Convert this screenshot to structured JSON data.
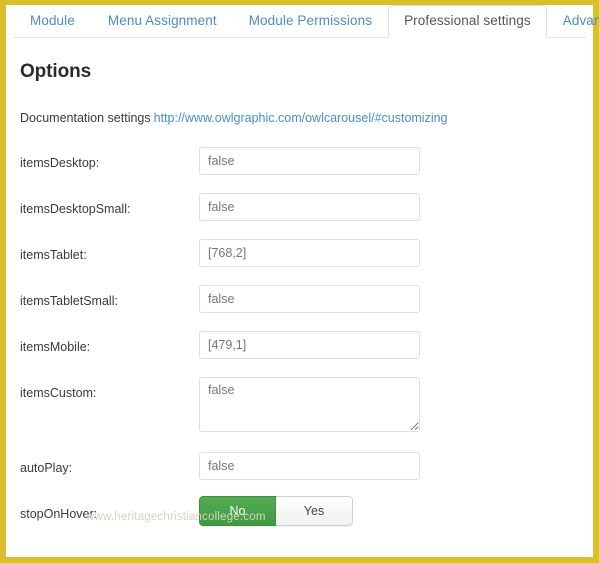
{
  "window": {
    "border_color": "#d9bf2b",
    "accent_link_color": "#4a8fc0",
    "toggle_green": "#449d44"
  },
  "tabs": [
    {
      "label": "Module",
      "active": false
    },
    {
      "label": "Menu Assignment",
      "active": false
    },
    {
      "label": "Module Permissions",
      "active": false
    },
    {
      "label": "Professional settings",
      "active": true
    },
    {
      "label": "Advanced",
      "active": false
    }
  ],
  "main": {
    "page_title": "Options",
    "documentation": {
      "label": "Documentation settings",
      "link_text": "http://www.owlgraphic.com/owlcarousel/#customizing"
    }
  },
  "fields": [
    {
      "label": "itemsDesktop:",
      "value": "false",
      "type": "text"
    },
    {
      "label": "itemsDesktopSmall:",
      "value": "false",
      "type": "text"
    },
    {
      "label": "itemsTablet:",
      "value": "[768,2]",
      "type": "text"
    },
    {
      "label": "itemsTabletSmall:",
      "value": "false",
      "type": "text"
    },
    {
      "label": "itemsMobile:",
      "value": "[479,1]",
      "type": "text"
    },
    {
      "label": "itemsCustom:",
      "value": "false",
      "type": "textarea"
    },
    {
      "label": "autoPlay:",
      "value": "false",
      "type": "text"
    },
    {
      "label": "stopOnHover:",
      "type": "toggle",
      "options": [
        {
          "label": "No",
          "selected": true
        },
        {
          "label": "Yes",
          "selected": false
        }
      ]
    }
  ],
  "watermark": "www.heritagechristiancollege.com"
}
